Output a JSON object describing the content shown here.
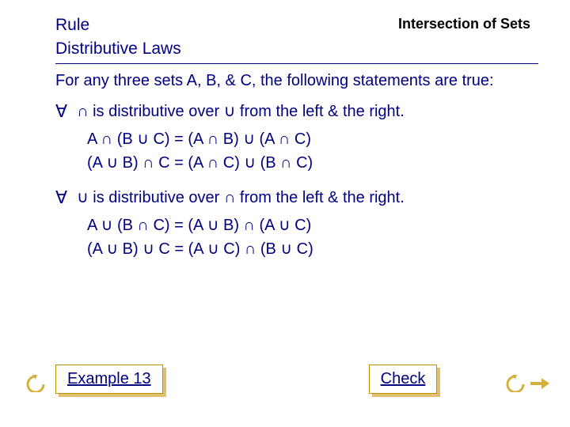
{
  "header": {
    "rule": "Rule",
    "topic": "Intersection of Sets",
    "subtitle": "Distributive Laws"
  },
  "intro": "For any three sets A, B, & C, the following statements are true:",
  "sym": {
    "forall": "∀",
    "cap": "∩",
    "cup": "∪"
  },
  "law1": {
    "text_a": "is distributive over",
    "text_b": "from the left & the right.",
    "eq1": "A ∩ (B ∪ C) = (A ∩ B) ∪ (A ∩ C)",
    "eq2": "(A ∪ B) ∩ C = (A ∩ C) ∪ (B ∩ C)"
  },
  "law2": {
    "text_a": "is distributive over",
    "text_b": "from the left & the right.",
    "eq1": "A ∪ (B ∩ C) = (A ∪ B) ∩ (A ∪ C)",
    "eq2": "(A ∪ B) ∪ C = (A ∪ C) ∩ (B ∪ C)"
  },
  "buttons": {
    "example": "Example 13",
    "check": "Check"
  }
}
